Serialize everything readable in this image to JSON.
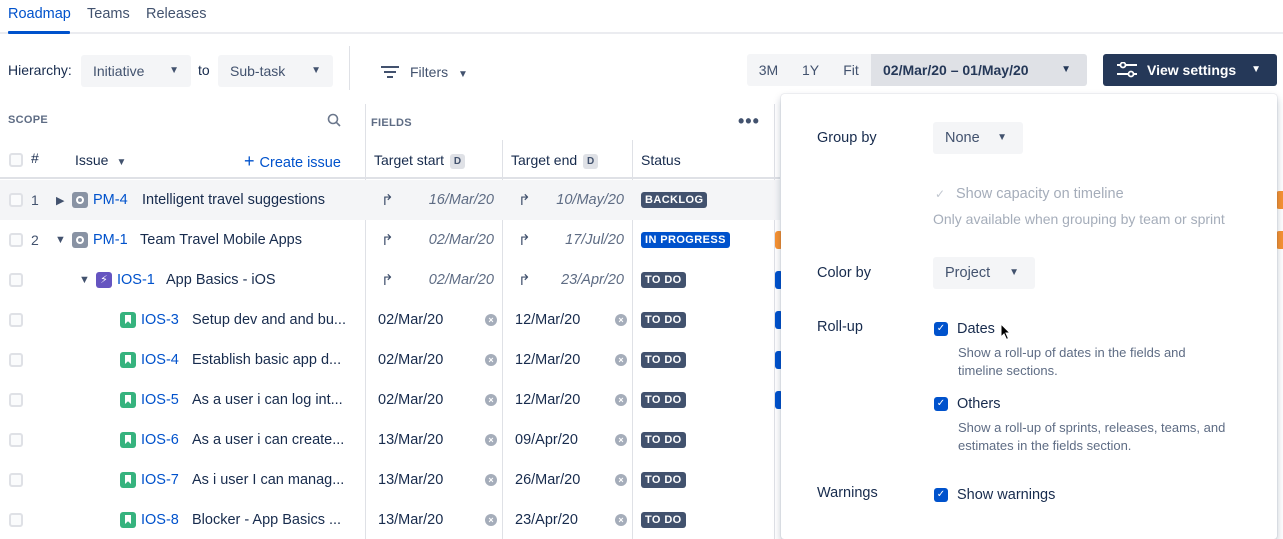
{
  "nav": {
    "tabs": [
      "Roadmap",
      "Teams",
      "Releases"
    ]
  },
  "toolbar": {
    "hierarchy_label": "Hierarchy:",
    "from_value": "Initiative",
    "to_label": "to",
    "to_value": "Sub-task",
    "filters_label": "Filters",
    "ranges": [
      "3M",
      "1Y",
      "Fit"
    ],
    "date_range": "02/Mar/20 – 01/May/20",
    "view_settings_label": "View settings"
  },
  "table": {
    "scope_heading": "SCOPE",
    "fields_heading": "FIELDS",
    "col_num": "#",
    "col_issue": "Issue",
    "create_issue": "Create issue",
    "col_target_start": "Target start",
    "col_target_end": "Target end",
    "col_status": "Status",
    "d_badge": "D",
    "rows": [
      {
        "num": "1",
        "key": "PM-4",
        "title": "Intelligent travel suggestions",
        "start": "16/Mar/20",
        "end": "10/May/20",
        "status": "BACKLOG"
      },
      {
        "num": "2",
        "key": "PM-1",
        "title": "Team Travel Mobile Apps",
        "start": "02/Mar/20",
        "end": "17/Jul/20",
        "status": "IN PROGRESS"
      },
      {
        "num": "",
        "key": "IOS-1",
        "title": "App Basics - iOS",
        "start": "02/Mar/20",
        "end": "23/Apr/20",
        "status": "TO DO"
      },
      {
        "num": "",
        "key": "IOS-3",
        "title": "Setup dev and and bu...",
        "start": "02/Mar/20",
        "end": "12/Mar/20",
        "status": "TO DO"
      },
      {
        "num": "",
        "key": "IOS-4",
        "title": "Establish basic app d...",
        "start": "02/Mar/20",
        "end": "12/Mar/20",
        "status": "TO DO"
      },
      {
        "num": "",
        "key": "IOS-5",
        "title": "As a user i can log int...",
        "start": "02/Mar/20",
        "end": "12/Mar/20",
        "status": "TO DO"
      },
      {
        "num": "",
        "key": "IOS-6",
        "title": "As a user i can create...",
        "start": "13/Mar/20",
        "end": "09/Apr/20",
        "status": "TO DO"
      },
      {
        "num": "",
        "key": "IOS-7",
        "title": "As i user I can manag...",
        "start": "13/Mar/20",
        "end": "26/Mar/20",
        "status": "TO DO"
      },
      {
        "num": "",
        "key": "IOS-8",
        "title": "Blocker - App Basics ...",
        "start": "13/Mar/20",
        "end": "23/Apr/20",
        "status": "TO DO"
      }
    ]
  },
  "panel": {
    "group_by_label": "Group by",
    "group_by_value": "None",
    "show_capacity": "Show capacity on timeline",
    "capacity_note": "Only available when grouping by team or sprint",
    "color_by_label": "Color by",
    "color_by_value": "Project",
    "rollup_label": "Roll-up",
    "dates_label": "Dates",
    "dates_desc_1": "Show a roll-up of dates in the fields and",
    "dates_desc_2": "timeline sections.",
    "others_label": "Others",
    "others_desc_1": "Show a roll-up of sprints, releases, teams, and",
    "others_desc_2": "estimates in the fields section.",
    "warnings_label": "Warnings",
    "show_warnings": "Show warnings"
  },
  "colors": {
    "accent": "#0052CC",
    "dark_button": "#253858",
    "story": "#36B37E",
    "epic": "#6554C0",
    "timeline_orange": "#F79232"
  }
}
